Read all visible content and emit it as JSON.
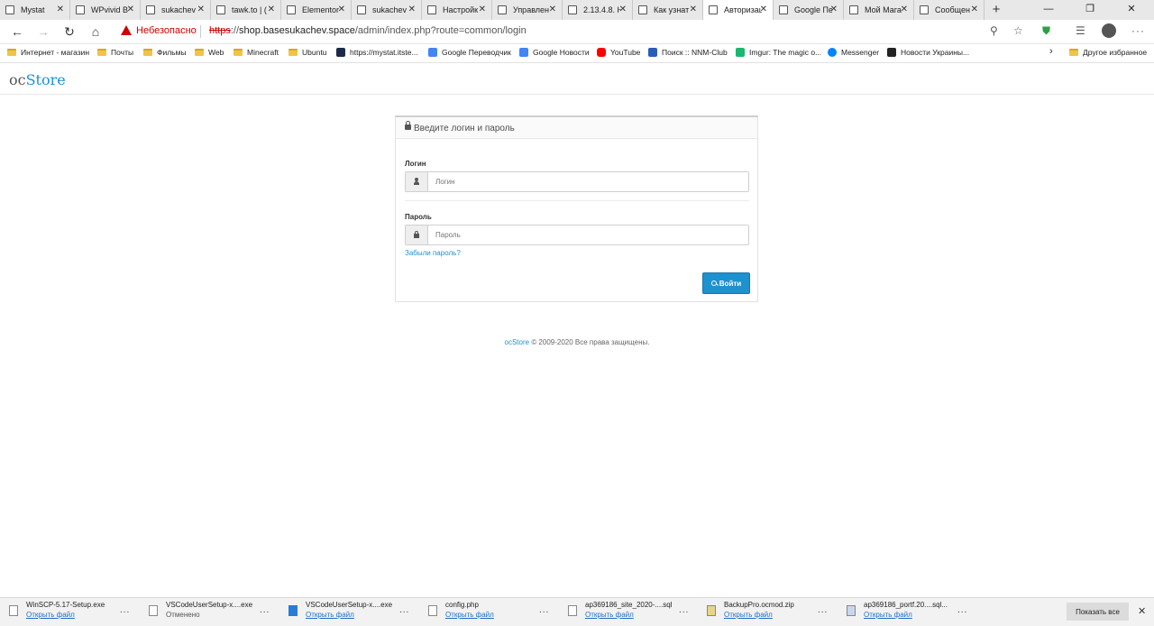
{
  "browser": {
    "tabs": [
      {
        "title": "Mystat",
        "active": false
      },
      {
        "title": "WPvivid B",
        "active": false
      },
      {
        "title": "sukachev",
        "active": false
      },
      {
        "title": "tawk.to | (",
        "active": false
      },
      {
        "title": "Elementor",
        "active": false
      },
      {
        "title": "sukachev",
        "active": false
      },
      {
        "title": "Настройк",
        "active": false
      },
      {
        "title": "Управлен",
        "active": false
      },
      {
        "title": "2.13.4.8. H",
        "active": false
      },
      {
        "title": "Как узнат",
        "active": false
      },
      {
        "title": "Авторизац",
        "active": true
      },
      {
        "title": "Google Пе",
        "active": false
      },
      {
        "title": "Мой Мага",
        "active": false
      },
      {
        "title": "Сообщен",
        "active": false
      }
    ],
    "new_tab": "+",
    "window_controls": {
      "minimize": "—",
      "maximize": "❐",
      "close": "✕"
    },
    "nav": {
      "back": "←",
      "forward": "→",
      "reload": "↻",
      "home": "⌂"
    },
    "security_warning": "Небезопасно",
    "url": {
      "protocol": "https",
      "separator": "://",
      "host": "shop.basesukachev.space",
      "path": "/admin/index.php?route=common/login"
    },
    "bookmarks": [
      {
        "label": "Интернет - магазин",
        "type": "folder"
      },
      {
        "label": "Почты",
        "type": "folder"
      },
      {
        "label": "Фильмы",
        "type": "folder"
      },
      {
        "label": "Web",
        "type": "folder"
      },
      {
        "label": "Minecraft",
        "type": "folder"
      },
      {
        "label": "Ubuntu",
        "type": "folder"
      },
      {
        "label": "https://mystat.itste...",
        "type": "site",
        "color": "#1a2b4a"
      },
      {
        "label": "Google Переводчик",
        "type": "site",
        "color": "#4285f4"
      },
      {
        "label": "Google Новости",
        "type": "site",
        "color": "#4285f4"
      },
      {
        "label": "YouTube",
        "type": "site",
        "color": "#ff0000"
      },
      {
        "label": "Поиск :: NNM-Club",
        "type": "site",
        "color": "#2b5db7"
      },
      {
        "label": "Imgur: The magic o...",
        "type": "site",
        "color": "#1bb76e"
      },
      {
        "label": "Messenger",
        "type": "site",
        "color": "#0084ff"
      },
      {
        "label": "Новости Украины...",
        "type": "site",
        "color": "#222222"
      }
    ],
    "other_bookmarks": "Другое избранное"
  },
  "site": {
    "logo_oc": "oc",
    "logo_store": "Store"
  },
  "login": {
    "heading": "Введите логин и пароль",
    "username_label": "Логин",
    "username_placeholder": "Логин",
    "password_label": "Пароль",
    "password_placeholder": "Пароль",
    "forgot": "Забыли пароль?",
    "submit": "Войти"
  },
  "footer": {
    "link": "ocStore",
    "text": " © 2009-2020 Все права защищены."
  },
  "downloads": {
    "items": [
      {
        "name": "WinSCP-5.17-Setup.exe",
        "action": "Открыть файл"
      },
      {
        "name": "VSCodeUserSetup-x....exe",
        "status": "Отменено"
      },
      {
        "name": "VSCodeUserSetup-x....exe",
        "action": "Открыть файл"
      },
      {
        "name": "config.php",
        "action": "Открыть файл"
      },
      {
        "name": "ap369186_site_2020-....sql",
        "action": "Открыть файл"
      },
      {
        "name": "BackupPro.ocmod.zip",
        "action": "Открыть файл"
      },
      {
        "name": "ap369186_portf.20....sql...",
        "action": "Открыть файл"
      }
    ],
    "more": "...",
    "show_all": "Показать все",
    "close": "✕"
  },
  "colors": {
    "accent": "#1e91cf",
    "warning": "#cc0000"
  }
}
